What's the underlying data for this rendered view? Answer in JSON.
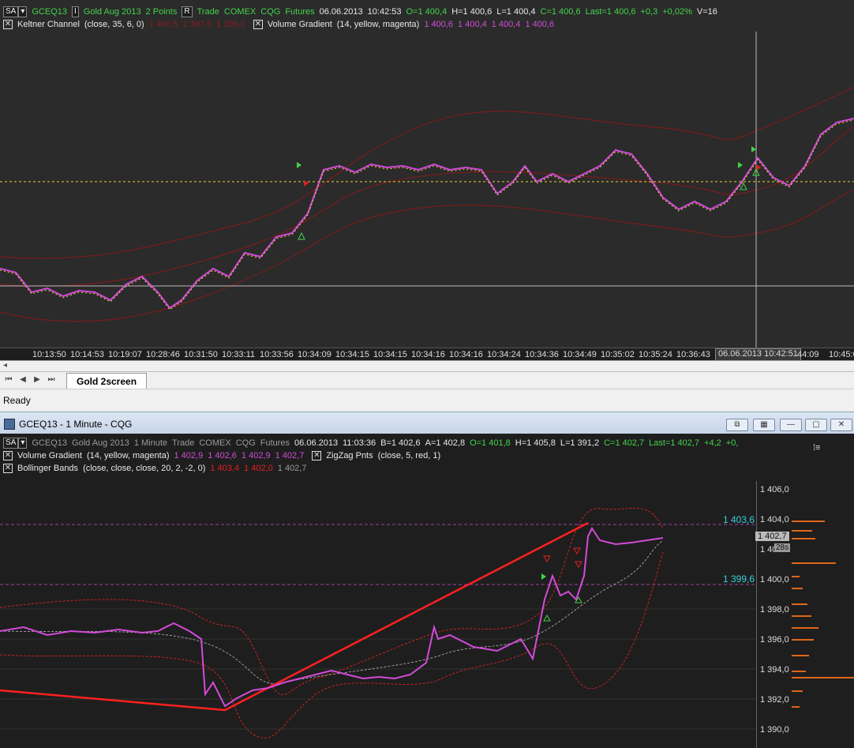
{
  "top_chart": {
    "symbol_box": "SA",
    "symbol": "GCEQ13",
    "interval_box": "I",
    "description": "Gold Aug 2013",
    "bar_type": "2 Points",
    "range_box": "R",
    "quote_type": "Trade",
    "exchange": "COMEX",
    "feed": "CQG",
    "market": "Futures",
    "date": "06.06.2013",
    "time": "10:42:53",
    "open": "O=1 400,4",
    "high": "H=1 400,6",
    "low": "L=1 400,4",
    "close": "C=1 400,6",
    "last": "Last=1 400,6",
    "change": "+0,3",
    "change_pct": "+0,02%",
    "volume": "V=16",
    "study1": {
      "name": "Keltner Channel",
      "params": "(close,  35,  6,  0)",
      "v1": "1 400,5",
      "v2": "1 397,6",
      "v3": "1 399,0"
    },
    "study2": {
      "name": "Volume Gradient",
      "params": "(14,  yellow,  magenta)",
      "v1": "1 400,6",
      "v2": "1 400,4",
      "v3": "1 400,4",
      "v4": "1 400,6"
    },
    "time_ticks": [
      "10:13:50",
      "10:14:53",
      "10:19:07",
      "10:28:46",
      "10:31:50",
      "10:33:11",
      "10:33:56",
      "10:34:09",
      "10:34:15",
      "10:34:15",
      "10:34:16",
      "10:34:16",
      "10:34:24",
      "10:34:36",
      "10:34:49",
      "10:35:02",
      "10:35:24",
      "10:36:43",
      "44:09",
      "10:45:0"
    ],
    "time_cursor": "06.06.2013  10:42:51"
  },
  "tab_bar": {
    "tab_label": "Gold 2screen"
  },
  "status_bar": {
    "text": "Ready"
  },
  "bottom_window": {
    "title": "GCEQ13 - 1 Minute - CQG"
  },
  "bottom_chart": {
    "symbol_box": "SA",
    "symbol": "GCEQ13",
    "description": "Gold Aug 2013",
    "bar_type": "1 Minute",
    "quote_type": "Trade",
    "exchange": "COMEX",
    "feed": "CQG",
    "market": "Futures",
    "date": "06.06.2013",
    "time": "11:03:36",
    "bid": "B=1 402,6",
    "ask": "A=1 402,8",
    "open": "O=1 401,8",
    "high": "H=1 405,8",
    "low": "L=1 391,2",
    "close": "C=1 402,7",
    "last": "Last=1 402,7",
    "change": "+4,2",
    "change_pct": "+0,",
    "study1": {
      "name": "Volume Gradient",
      "params": "(14,  yellow,  magenta)",
      "v1": "1 402,9",
      "v2": "1 402,6",
      "v3": "1 402,9",
      "v4": "1 402,7"
    },
    "study2": {
      "name": "ZigZag Pnts",
      "params": "(close,  5,  red,  1)"
    },
    "study3": {
      "name": "Bollinger Bands",
      "params": "(close,  close,  close,  20,  2,  -2,  0)",
      "v1": "1 403,4",
      "v2": "1 402,0",
      "v3": "1 402,7"
    },
    "price_labels": [
      "1 406,0",
      "1 404,0",
      "1 40",
      "1 400,0",
      "1 398,0",
      "1 396,0",
      "1 394,0",
      "1 392,0",
      "1 390,0"
    ],
    "level_high": "1 403,6",
    "level_low": "1 399,6",
    "last_box": "1 402,7",
    "countdown": "28s"
  },
  "colors": {
    "green": "#42d44a",
    "magenta": "#d24bd8",
    "yellow": "#e6d23a",
    "red": "#e02020",
    "dark_red": "#8a1c1c",
    "cyan": "#38d0e0"
  }
}
